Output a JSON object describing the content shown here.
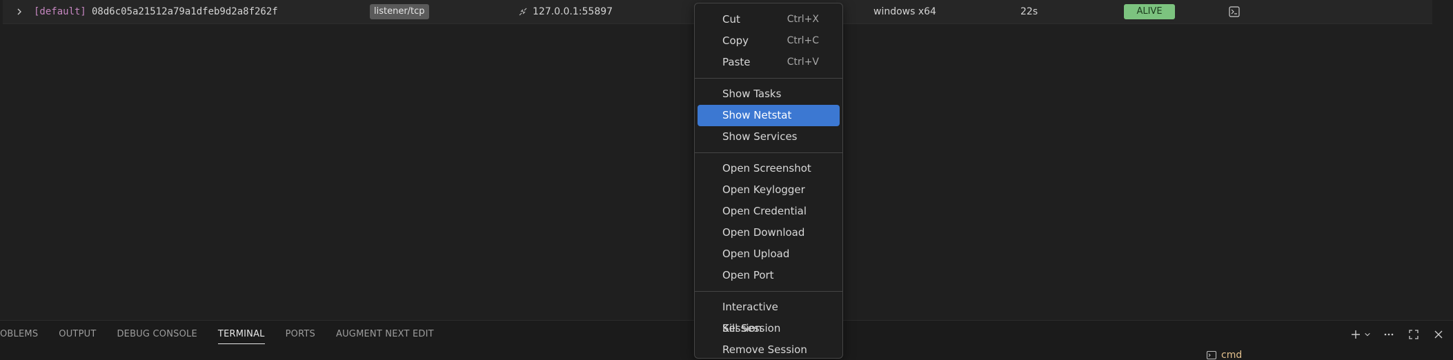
{
  "session": {
    "tag": "[default]",
    "id": "08d6c05a21512a79a1dfeb9d2a8f262f",
    "listener": "listener/tcp",
    "address": "127.0.0.1:55897",
    "os": "windows x64",
    "age": "22s",
    "status": "ALIVE",
    "status_color": "#7cc37f"
  },
  "menu": {
    "groups": [
      [
        {
          "label": "Cut",
          "shortcut": "Ctrl+X"
        },
        {
          "label": "Copy",
          "shortcut": "Ctrl+C"
        },
        {
          "label": "Paste",
          "shortcut": "Ctrl+V"
        }
      ],
      [
        {
          "label": "Show Tasks"
        },
        {
          "label": "Show Netstat",
          "selected": true
        },
        {
          "label": "Show Services"
        }
      ],
      [
        {
          "label": "Open Screenshot"
        },
        {
          "label": "Open Keylogger"
        },
        {
          "label": "Open Credential"
        },
        {
          "label": "Open Download"
        },
        {
          "label": "Open Upload"
        },
        {
          "label": "Open Port"
        }
      ],
      [
        {
          "label": "Interactive Session"
        },
        {
          "label": "Kill Session"
        },
        {
          "label": "Remove Session"
        }
      ]
    ],
    "highlight_color": "#3c78d2"
  },
  "panel": {
    "tabs": [
      "OBLEMS",
      "OUTPUT",
      "DEBUG CONSOLE",
      "TERMINAL",
      "PORTS",
      "AUGMENT NEXT EDIT"
    ],
    "active_tab": "TERMINAL",
    "terminal_entry": "cmd"
  }
}
